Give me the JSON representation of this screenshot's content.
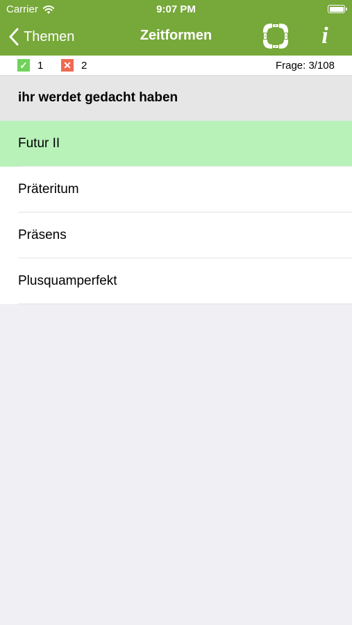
{
  "status_bar": {
    "carrier": "Carrier",
    "time": "9:07 PM"
  },
  "nav": {
    "back_label": "Themen",
    "title": "Zeitformen",
    "info_label": "i"
  },
  "score": {
    "correct_count": "1",
    "wrong_count": "2",
    "progress": "Frage: 3/108"
  },
  "question": {
    "text": "ihr werdet gedacht haben"
  },
  "answers": [
    {
      "label": "Futur II",
      "selected": true
    },
    {
      "label": "Präteritum",
      "selected": false
    },
    {
      "label": "Präsens",
      "selected": false
    },
    {
      "label": "Plusquamperfekt",
      "selected": false
    }
  ],
  "colors": {
    "header": "#77a83a",
    "selected_answer": "#b8f2b9",
    "correct": "#6fd35a",
    "wrong": "#ef6a52",
    "background": "#efeff4"
  },
  "icons": {
    "correct": "checkmark-icon",
    "wrong": "cross-icon",
    "help": "lifebuoy-icon",
    "back": "chevron-left-icon"
  }
}
